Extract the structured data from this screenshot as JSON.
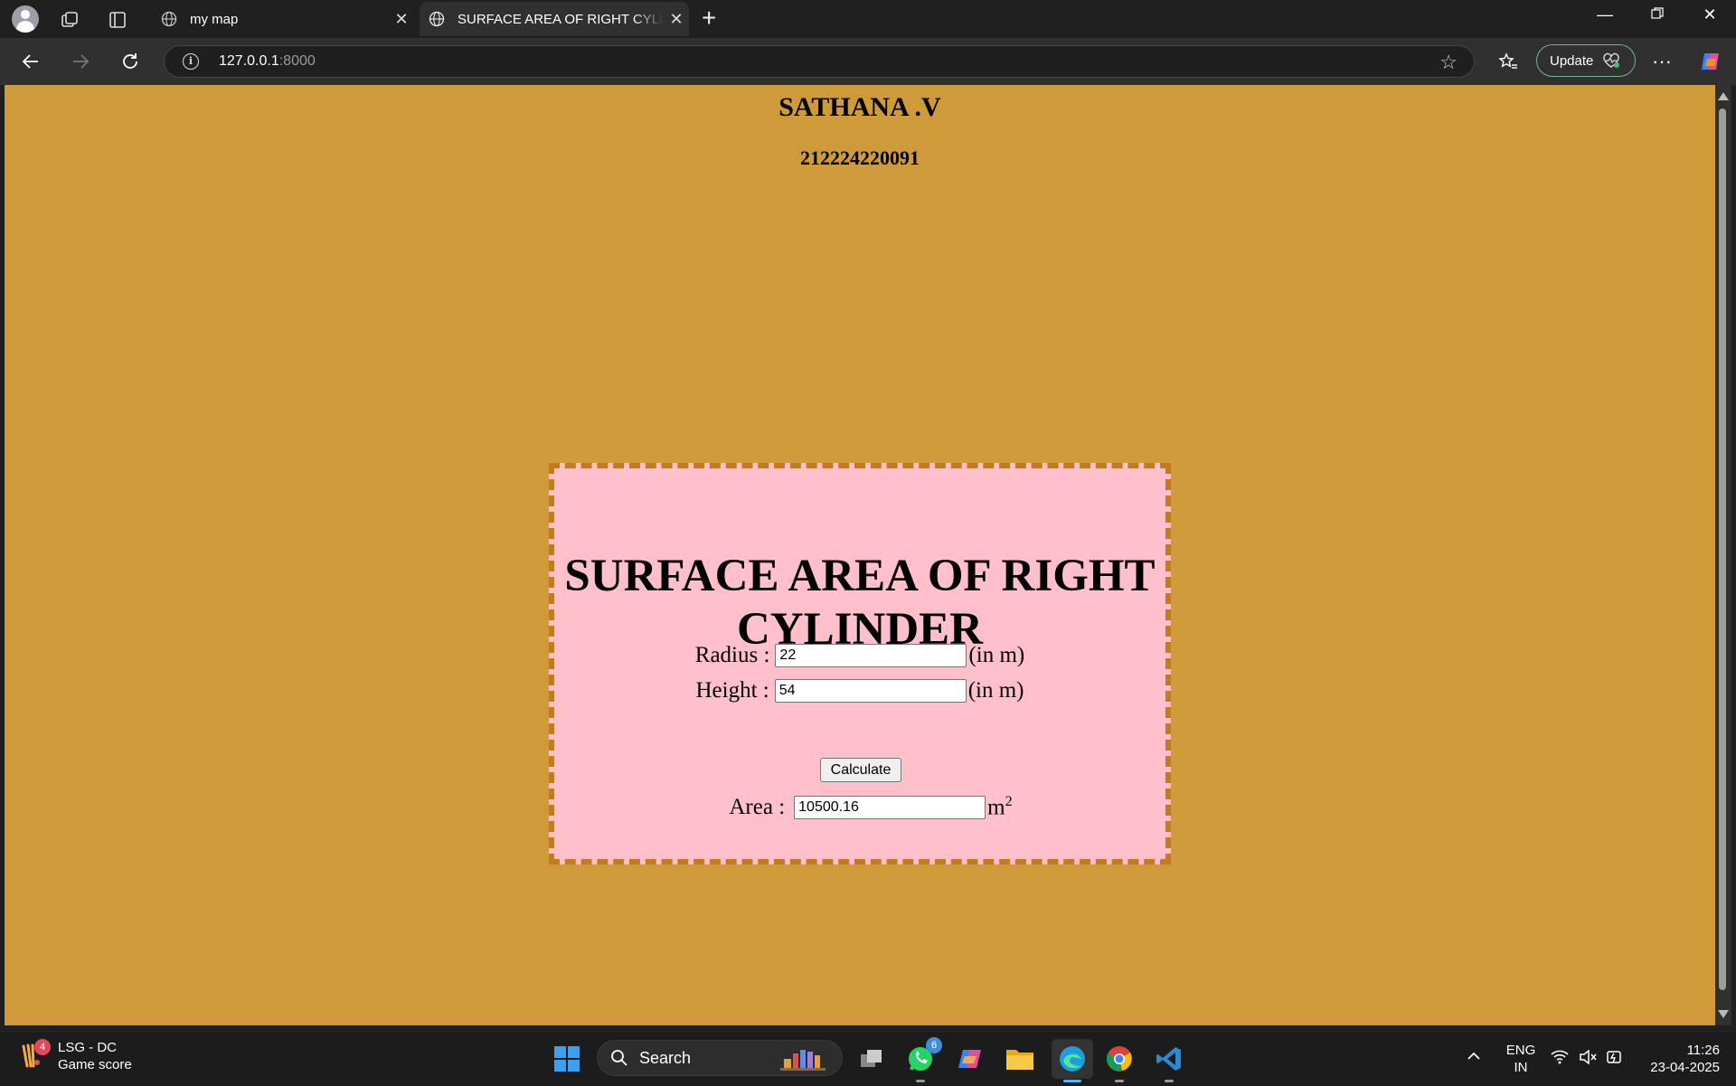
{
  "browser": {
    "tabs": [
      {
        "title": "my map",
        "active": false
      },
      {
        "title": "SURFACE AREA OF RIGHT CYLINDER",
        "active": true
      }
    ],
    "address": {
      "host": "127.0.0.1",
      "port": ":8000"
    },
    "update_label": "Update"
  },
  "page": {
    "student_name": "SATHANA .V",
    "student_id": "212224220091",
    "title": "SURFACE AREA OF RIGHT CYLINDER",
    "background_color": "#CF9B3A",
    "card_color": "#FFC0CB",
    "card_border_color": "#C47A1E",
    "form": {
      "radius_label": "Radius :",
      "radius_value": "22",
      "radius_unit": "(in m)",
      "height_label": "Height :",
      "height_value": "54",
      "height_unit": "(in m)",
      "calculate_label": "Calculate",
      "area_label": "Area :",
      "area_value": "10500.16",
      "area_unit": "m",
      "area_unit_sup": "2"
    }
  },
  "taskbar": {
    "widget_badge": "4",
    "widget_title": "LSG - DC",
    "widget_subtitle": "Game score",
    "search_label": "Search",
    "whatsapp_badge": "6",
    "lang_line1": "ENG",
    "lang_line2": "IN",
    "time": "11:26",
    "date": "23-04-2025"
  }
}
